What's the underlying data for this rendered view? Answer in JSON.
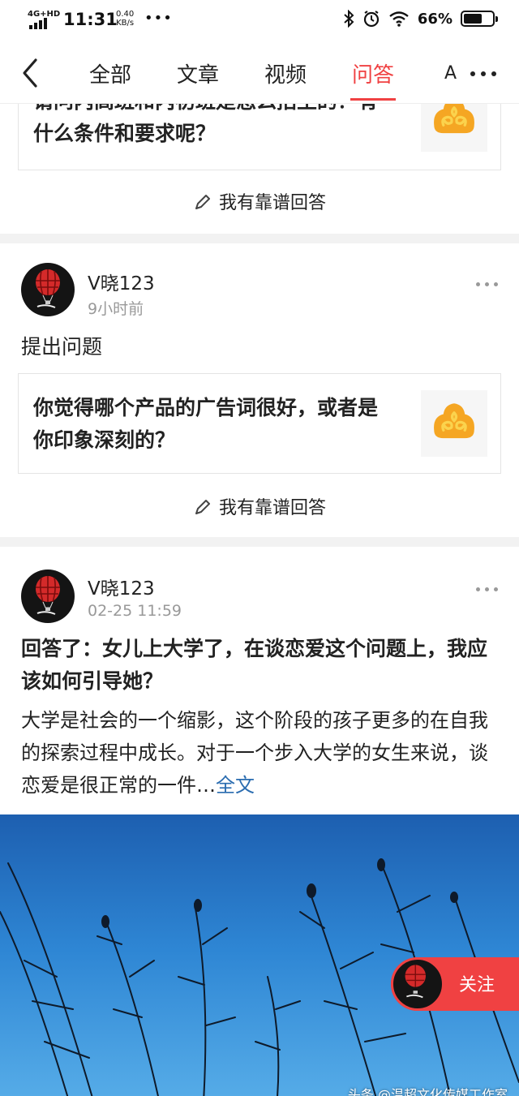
{
  "status_bar": {
    "network": "4G+HD",
    "time": "11:31",
    "speed_value": "0.40",
    "speed_unit": "KB/s",
    "dots": "•••",
    "battery_percent": "66%",
    "battery_level": 0.66
  },
  "nav": {
    "back_icon": "chevron-left-icon",
    "tabs": [
      {
        "label": "全部",
        "active": false
      },
      {
        "label": "文章",
        "active": false
      },
      {
        "label": "视频",
        "active": false
      },
      {
        "label": "问答",
        "active": true
      }
    ],
    "peek_tab": "A",
    "more_icon": "more-dots-icon",
    "accent_color": "#f04142"
  },
  "feed": {
    "item0": {
      "question": "请问内高班和内初班是怎么招生的？有什么条件和要求呢？",
      "answer_link": "我有靠谱回答"
    },
    "item1": {
      "username": "V晓123",
      "time": "9小时前",
      "action": "提出问题",
      "question": "你觉得哪个产品的广告词很好，或者是你印象深刻的？",
      "answer_link": "我有靠谱回答"
    },
    "item2": {
      "username": "V晓123",
      "time": "02-25 11:59",
      "title": "回答了：女儿上大学了，在谈恋爱这个问题上，我应该如何引导她？",
      "body": "大学是社会的一个缩影，这个阶段的孩子更多的在自我的探索过程中成长。对于一个步入大学的女生来说，谈恋爱是很正常的一件…",
      "full_text_label": "全文",
      "follow_label": "关注",
      "watermark": "头条 @温超文化传媒工作室"
    }
  }
}
